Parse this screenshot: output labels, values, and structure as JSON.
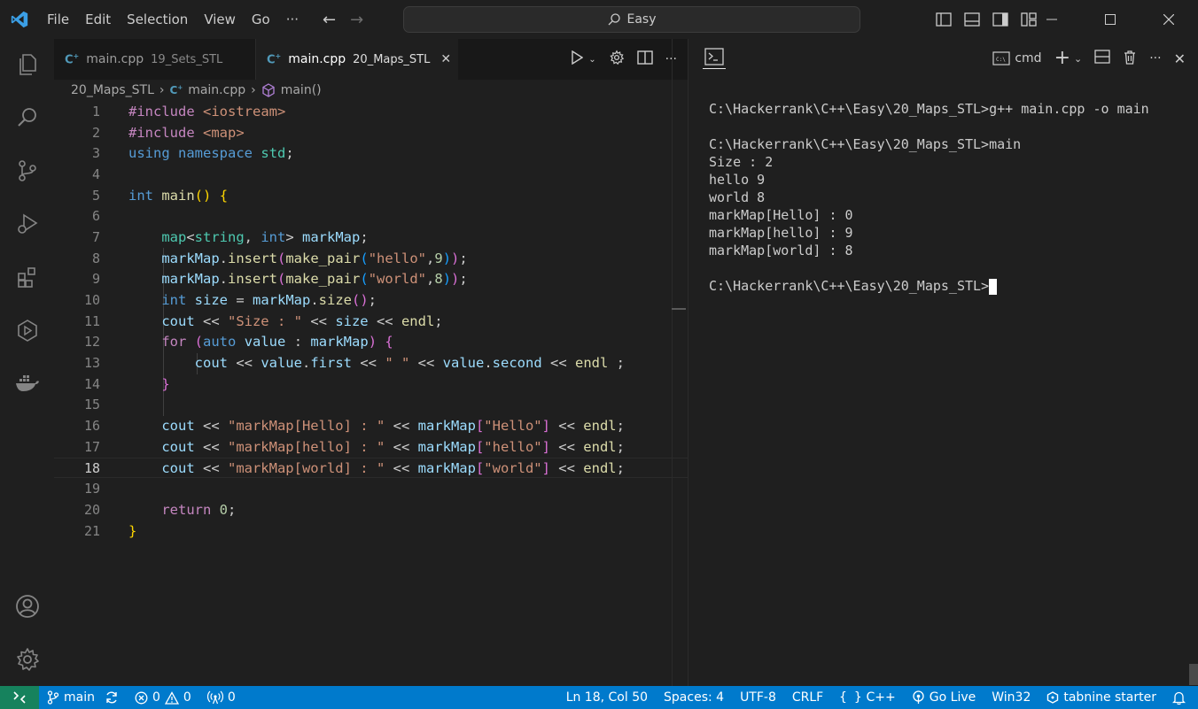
{
  "titlebar": {
    "menu": [
      "File",
      "Edit",
      "Selection",
      "View",
      "Go",
      "···"
    ],
    "search_text": "Easy"
  },
  "tabs": [
    {
      "label": "main.cpp",
      "sub": "19_Sets_STL",
      "active": false
    },
    {
      "label": "main.cpp",
      "sub": "20_Maps_STL",
      "active": true
    }
  ],
  "breadcrumb": {
    "folder": "20_Maps_STL",
    "file": "main.cpp",
    "symbol": "main()"
  },
  "editor": {
    "line_numbers": [
      "1",
      "2",
      "3",
      "4",
      "5",
      "6",
      "7",
      "8",
      "9",
      "10",
      "11",
      "12",
      "13",
      "14",
      "15",
      "16",
      "17",
      "18",
      "19",
      "20",
      "21"
    ],
    "current_line": "18"
  },
  "terminal": {
    "shell_label": "cmd",
    "lines": [
      "C:\\Hackerrank\\C++\\Easy\\20_Maps_STL>g++ main.cpp -o main",
      "",
      "C:\\Hackerrank\\C++\\Easy\\20_Maps_STL>main",
      "Size : 2",
      "hello 9",
      "world 8",
      "markMap[Hello] : 0",
      "markMap[hello] : 9",
      "markMap[world] : 8",
      ""
    ],
    "prompt": "C:\\Hackerrank\\C++\\Easy\\20_Maps_STL>"
  },
  "statusbar": {
    "branch": "main",
    "errors": "0",
    "warnings": "0",
    "ports": "0",
    "position": "Ln 18, Col 50",
    "spaces": "Spaces: 4",
    "encoding": "UTF-8",
    "eol": "CRLF",
    "language": "C++",
    "golive": "Go Live",
    "platform": "Win32",
    "tabnine": "tabnine starter"
  },
  "colors": {
    "accent": "#007acc",
    "remote": "#16825d",
    "logo": "#3b9fe6"
  }
}
